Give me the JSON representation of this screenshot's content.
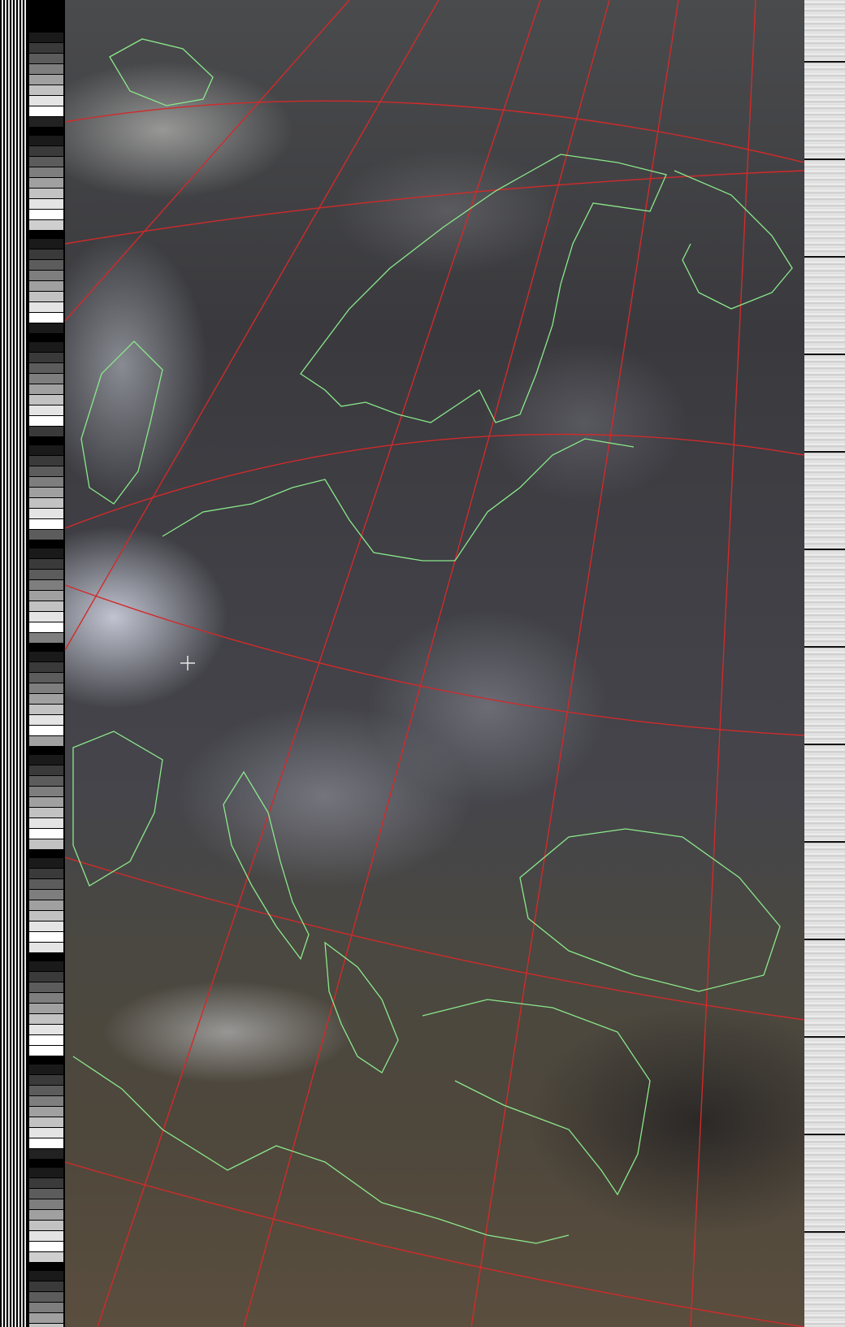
{
  "image": {
    "description_type": "satellite-weather-image",
    "overlay_line_colors": {
      "graticule": "#d22a2a",
      "coastlines": "#8be88b"
    },
    "strip_colors": {
      "sync": "#e6e6e6",
      "telemetry": "#efefef"
    }
  }
}
